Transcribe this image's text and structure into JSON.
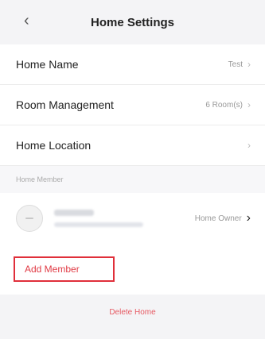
{
  "header": {
    "back_icon": "chevron-left-icon",
    "title": "Home Settings"
  },
  "rows": [
    {
      "label": "Home Name",
      "value": "Test"
    },
    {
      "label": "Room Management",
      "value": "6 Room(s)"
    },
    {
      "label": "Home Location",
      "value": ""
    }
  ],
  "section": {
    "label": "Home Member"
  },
  "member": {
    "role": "Home Owner"
  },
  "actions": {
    "add_member": "Add Member",
    "delete_home": "Delete Home"
  },
  "colors": {
    "accent": "#e02f3a",
    "background": "#f4f4f6"
  }
}
